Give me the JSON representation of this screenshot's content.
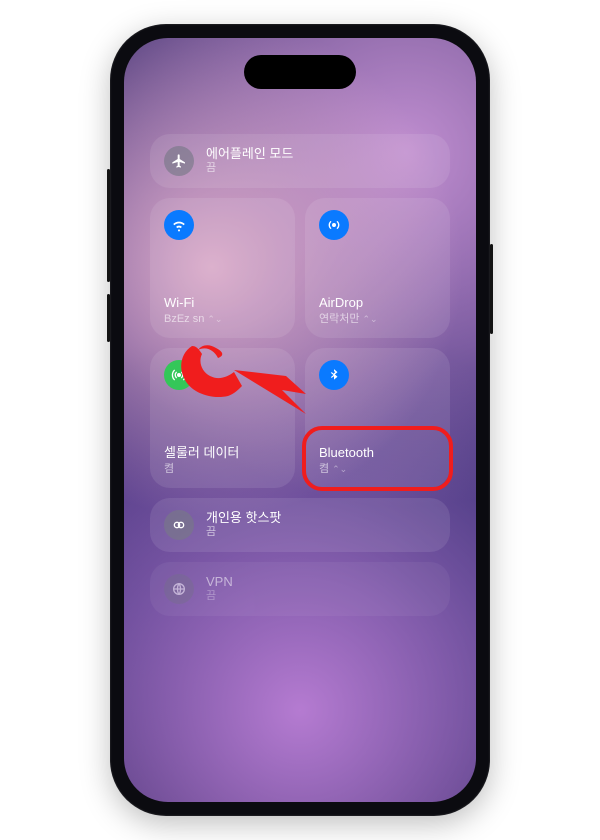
{
  "airplane": {
    "label": "에어플레인 모드",
    "status": "끔"
  },
  "wifi": {
    "label": "Wi-Fi",
    "status": "BzEz sn"
  },
  "airdrop": {
    "label": "AirDrop",
    "status": "연락처만"
  },
  "cellular": {
    "label": "셀룰러 데이터",
    "status": "켬"
  },
  "bluetooth": {
    "label": "Bluetooth",
    "status": "켬"
  },
  "hotspot": {
    "label": "개인용 핫스팟",
    "status": "끔"
  },
  "vpn": {
    "label": "VPN",
    "status": "끔"
  },
  "colors": {
    "annotation": "#f01d1d"
  }
}
